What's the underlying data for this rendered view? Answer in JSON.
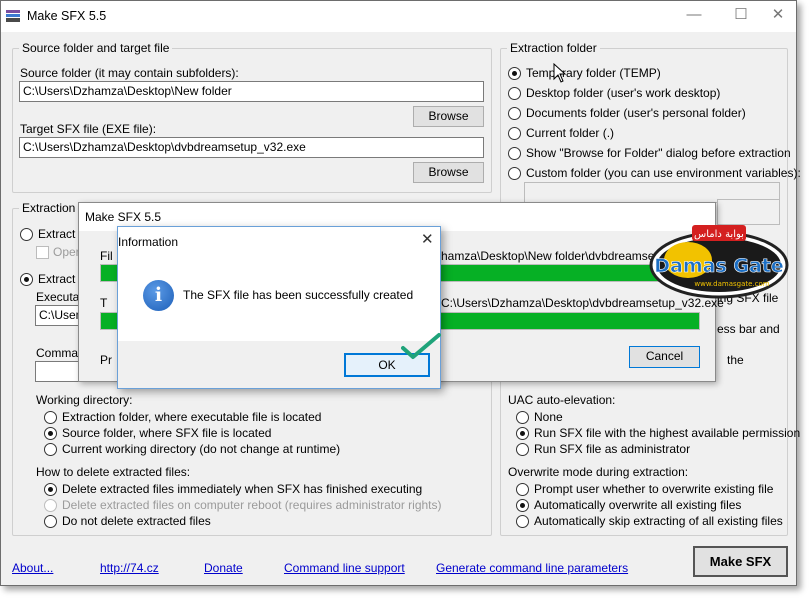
{
  "window": {
    "title": "Make SFX 5.5",
    "controls": {
      "minimize": "—",
      "maximize": "☐",
      "close": "✕"
    }
  },
  "source_group": {
    "label": "Source folder and target file",
    "source_label": "Source folder (it may contain subfolders):",
    "source_value": "C:\\Users\\Dzhamza\\Desktop\\New folder",
    "browse1": "Browse",
    "target_label": "Target SFX file (EXE file):",
    "target_value": "C:\\Users\\Dzhamza\\Desktop\\dvbdreamsetup_v32.exe",
    "browse2": "Browse"
  },
  "extraction_folder": {
    "label": "Extraction folder",
    "options": [
      "Temporary folder (TEMP)",
      "Desktop folder (user's work desktop)",
      "Documents folder (user's personal folder)",
      "Current folder (.)",
      "Show \"Browse for Folder\" dialog before extraction",
      "Custom folder (you can use environment variables):"
    ],
    "selected_index": 0
  },
  "extraction_mode": {
    "label": "Extraction m",
    "opt1": "Extract f",
    "sub1": "Oper",
    "opt2": "Extract f",
    "exec_label": "Executa",
    "exec_value": "C:\\Usen",
    "cmd_label": "Comman"
  },
  "right_partial": {
    "sfx_text": "ing SFX file",
    "progress_text": "ess bar and",
    "the_text": "the"
  },
  "working_dir": {
    "label": "Working directory:",
    "options": [
      "Extraction folder, where executable file is located",
      "Source folder, where SFX file is located",
      "Current working directory (do not change at runtime)"
    ],
    "selected_index": 1
  },
  "delete_files": {
    "label": "How to delete extracted files:",
    "options": [
      "Delete extracted files immediately when SFX has finished executing",
      "Delete extracted files on computer reboot (requires administrator rights)",
      "Do not delete extracted files"
    ],
    "selected_index": 0,
    "disabled_index": 1
  },
  "uac": {
    "label": "UAC auto-elevation:",
    "options": [
      "None",
      "Run SFX file with the highest available permission",
      "Run SFX file as administrator"
    ],
    "selected_index": 1
  },
  "overwrite": {
    "label": "Overwrite mode during extraction:",
    "options": [
      "Prompt user whether to overwrite existing file",
      "Automatically overwrite all existing files",
      "Automatically skip extracting of all existing files"
    ],
    "selected_index": 1
  },
  "footer": {
    "links": [
      "About...",
      "http://74.cz",
      "Donate",
      "Command line support",
      "Generate command line parameters"
    ],
    "make_sfx": "Make SFX"
  },
  "progress_dialog": {
    "title": "Make SFX 5.5",
    "label1": "Fil",
    "path1": "hamza\\Desktop\\New folder\\dvbdreamsetup",
    "label2": "T",
    "path2": "C:\\Users\\Dzhamza\\Desktop\\dvbdreamsetup_v32.exe",
    "label3": "Pr",
    "progress1": 1.0,
    "progress2": 1.0,
    "cancel": "Cancel"
  },
  "info_dialog": {
    "title": "Information",
    "message": "The SFX file has been successfully created",
    "ok": "OK",
    "close": "✕",
    "icon": "info-icon"
  },
  "watermark": {
    "arabic": "بوابة داماس",
    "brand": "Damas Gate",
    "url": "www.damasgate.com"
  },
  "colors": {
    "progress_green": "#06b025",
    "focus_blue": "#0078d7",
    "check_green": "#1fa37a"
  }
}
